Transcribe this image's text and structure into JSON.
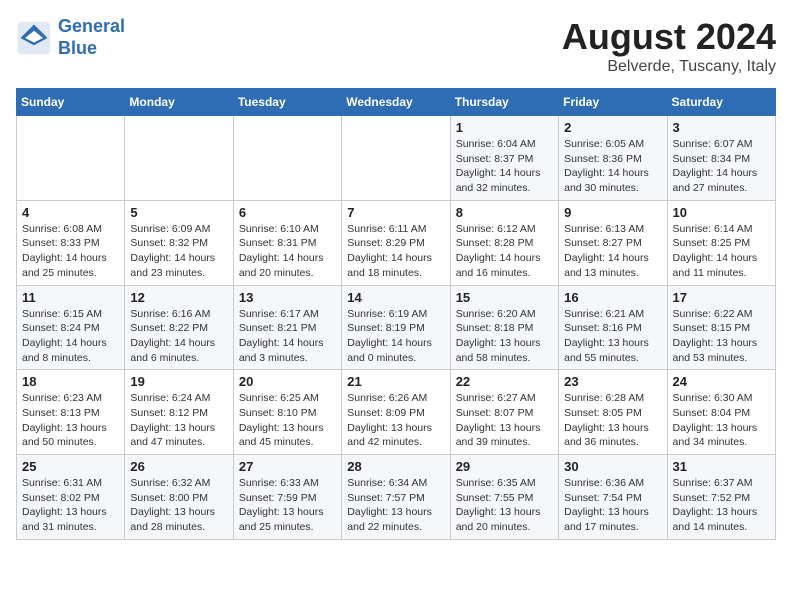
{
  "header": {
    "logo_line1": "General",
    "logo_line2": "Blue",
    "title": "August 2024",
    "subtitle": "Belverde, Tuscany, Italy"
  },
  "weekdays": [
    "Sunday",
    "Monday",
    "Tuesday",
    "Wednesday",
    "Thursday",
    "Friday",
    "Saturday"
  ],
  "weeks": [
    [
      {
        "day": "",
        "detail": ""
      },
      {
        "day": "",
        "detail": ""
      },
      {
        "day": "",
        "detail": ""
      },
      {
        "day": "",
        "detail": ""
      },
      {
        "day": "1",
        "detail": "Sunrise: 6:04 AM\nSunset: 8:37 PM\nDaylight: 14 hours\nand 32 minutes."
      },
      {
        "day": "2",
        "detail": "Sunrise: 6:05 AM\nSunset: 8:36 PM\nDaylight: 14 hours\nand 30 minutes."
      },
      {
        "day": "3",
        "detail": "Sunrise: 6:07 AM\nSunset: 8:34 PM\nDaylight: 14 hours\nand 27 minutes."
      }
    ],
    [
      {
        "day": "4",
        "detail": "Sunrise: 6:08 AM\nSunset: 8:33 PM\nDaylight: 14 hours\nand 25 minutes."
      },
      {
        "day": "5",
        "detail": "Sunrise: 6:09 AM\nSunset: 8:32 PM\nDaylight: 14 hours\nand 23 minutes."
      },
      {
        "day": "6",
        "detail": "Sunrise: 6:10 AM\nSunset: 8:31 PM\nDaylight: 14 hours\nand 20 minutes."
      },
      {
        "day": "7",
        "detail": "Sunrise: 6:11 AM\nSunset: 8:29 PM\nDaylight: 14 hours\nand 18 minutes."
      },
      {
        "day": "8",
        "detail": "Sunrise: 6:12 AM\nSunset: 8:28 PM\nDaylight: 14 hours\nand 16 minutes."
      },
      {
        "day": "9",
        "detail": "Sunrise: 6:13 AM\nSunset: 8:27 PM\nDaylight: 14 hours\nand 13 minutes."
      },
      {
        "day": "10",
        "detail": "Sunrise: 6:14 AM\nSunset: 8:25 PM\nDaylight: 14 hours\nand 11 minutes."
      }
    ],
    [
      {
        "day": "11",
        "detail": "Sunrise: 6:15 AM\nSunset: 8:24 PM\nDaylight: 14 hours\nand 8 minutes."
      },
      {
        "day": "12",
        "detail": "Sunrise: 6:16 AM\nSunset: 8:22 PM\nDaylight: 14 hours\nand 6 minutes."
      },
      {
        "day": "13",
        "detail": "Sunrise: 6:17 AM\nSunset: 8:21 PM\nDaylight: 14 hours\nand 3 minutes."
      },
      {
        "day": "14",
        "detail": "Sunrise: 6:19 AM\nSunset: 8:19 PM\nDaylight: 14 hours\nand 0 minutes."
      },
      {
        "day": "15",
        "detail": "Sunrise: 6:20 AM\nSunset: 8:18 PM\nDaylight: 13 hours\nand 58 minutes."
      },
      {
        "day": "16",
        "detail": "Sunrise: 6:21 AM\nSunset: 8:16 PM\nDaylight: 13 hours\nand 55 minutes."
      },
      {
        "day": "17",
        "detail": "Sunrise: 6:22 AM\nSunset: 8:15 PM\nDaylight: 13 hours\nand 53 minutes."
      }
    ],
    [
      {
        "day": "18",
        "detail": "Sunrise: 6:23 AM\nSunset: 8:13 PM\nDaylight: 13 hours\nand 50 minutes."
      },
      {
        "day": "19",
        "detail": "Sunrise: 6:24 AM\nSunset: 8:12 PM\nDaylight: 13 hours\nand 47 minutes."
      },
      {
        "day": "20",
        "detail": "Sunrise: 6:25 AM\nSunset: 8:10 PM\nDaylight: 13 hours\nand 45 minutes."
      },
      {
        "day": "21",
        "detail": "Sunrise: 6:26 AM\nSunset: 8:09 PM\nDaylight: 13 hours\nand 42 minutes."
      },
      {
        "day": "22",
        "detail": "Sunrise: 6:27 AM\nSunset: 8:07 PM\nDaylight: 13 hours\nand 39 minutes."
      },
      {
        "day": "23",
        "detail": "Sunrise: 6:28 AM\nSunset: 8:05 PM\nDaylight: 13 hours\nand 36 minutes."
      },
      {
        "day": "24",
        "detail": "Sunrise: 6:30 AM\nSunset: 8:04 PM\nDaylight: 13 hours\nand 34 minutes."
      }
    ],
    [
      {
        "day": "25",
        "detail": "Sunrise: 6:31 AM\nSunset: 8:02 PM\nDaylight: 13 hours\nand 31 minutes."
      },
      {
        "day": "26",
        "detail": "Sunrise: 6:32 AM\nSunset: 8:00 PM\nDaylight: 13 hours\nand 28 minutes."
      },
      {
        "day": "27",
        "detail": "Sunrise: 6:33 AM\nSunset: 7:59 PM\nDaylight: 13 hours\nand 25 minutes."
      },
      {
        "day": "28",
        "detail": "Sunrise: 6:34 AM\nSunset: 7:57 PM\nDaylight: 13 hours\nand 22 minutes."
      },
      {
        "day": "29",
        "detail": "Sunrise: 6:35 AM\nSunset: 7:55 PM\nDaylight: 13 hours\nand 20 minutes."
      },
      {
        "day": "30",
        "detail": "Sunrise: 6:36 AM\nSunset: 7:54 PM\nDaylight: 13 hours\nand 17 minutes."
      },
      {
        "day": "31",
        "detail": "Sunrise: 6:37 AM\nSunset: 7:52 PM\nDaylight: 13 hours\nand 14 minutes."
      }
    ]
  ]
}
